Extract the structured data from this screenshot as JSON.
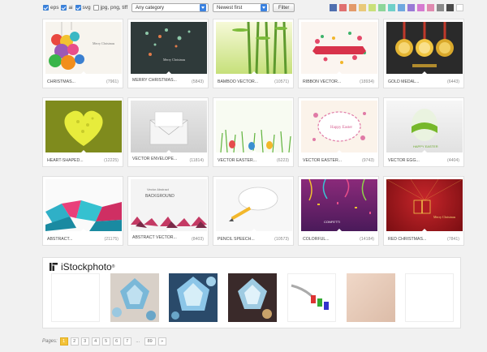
{
  "filters": {
    "formats": [
      {
        "label": "eps",
        "checked": true
      },
      {
        "label": "ai",
        "checked": true
      },
      {
        "label": "svg",
        "checked": true
      },
      {
        "label": "jpg, png, tiff",
        "checked": false
      }
    ],
    "category": "Any category",
    "sort": "Newest first",
    "filter_label": "Filter",
    "swatch_colors": [
      "#4f6fb0",
      "#e07070",
      "#e39a6a",
      "#e9c97a",
      "#c9e07a",
      "#8dd69a",
      "#6fd0c9",
      "#6fa8e0",
      "#9a7ad6",
      "#d67ad0",
      "#e08ab0",
      "#8a8a8a",
      "#4a4a4a",
      "#ffffff"
    ]
  },
  "items": [
    {
      "title": "CHRISTMAS...",
      "count": "(7961)"
    },
    {
      "title": "MERRY CHRISTMAS...",
      "count": "(5843)"
    },
    {
      "title": "BAMBOO VECTOR...",
      "count": "(10571)"
    },
    {
      "title": "RIBBON VECTOR...",
      "count": "(18934)"
    },
    {
      "title": "GOLD MEDAL...",
      "count": "(6443)"
    },
    {
      "title": "HEART-SHAPED...",
      "count": "(12225)"
    },
    {
      "title": "VECTOR ENVELOPE...",
      "count": "(11814)"
    },
    {
      "title": "VECTOR EASTER...",
      "count": "(6223)"
    },
    {
      "title": "VECTOR EASTER...",
      "count": "(9743)"
    },
    {
      "title": "VECTOR EGG...",
      "count": "(4404)"
    },
    {
      "title": "ABSTRACT...",
      "count": "(21175)"
    },
    {
      "title": "ABSTRACT VECTOR...",
      "count": "(8403)"
    },
    {
      "title": "PENCIL SPEECH...",
      "count": "(10573)"
    },
    {
      "title": "COLORFUL...",
      "count": "(14184)"
    },
    {
      "title": "RED CHRISTMAS...",
      "count": "(7841)"
    }
  ],
  "istock": {
    "brand": "iStockphoto",
    "trademark": "®"
  },
  "pager": {
    "label": "Pages:",
    "pages": [
      "1",
      "2",
      "3",
      "4",
      "5",
      "6",
      "7",
      "...",
      "89",
      "»"
    ],
    "active": "1"
  }
}
